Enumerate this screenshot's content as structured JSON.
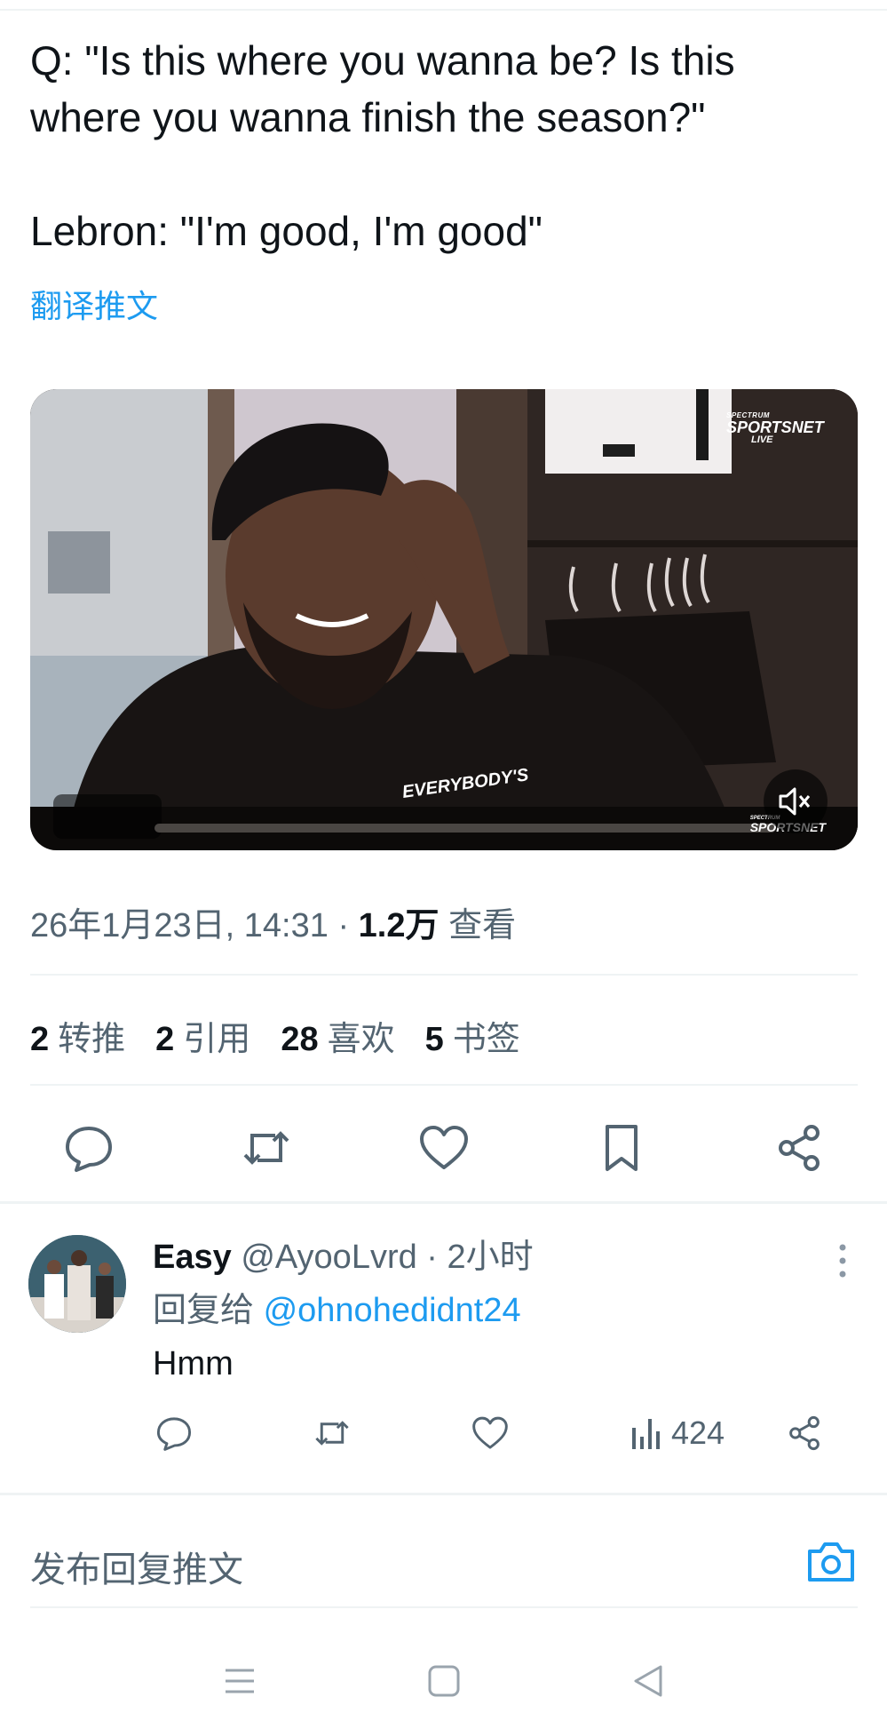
{
  "tweet": {
    "line1": "Q: \"Is this where you wanna be? Is this",
    "line2": "where you wanna finish the season?\"",
    "line3": "Lebron: \"I'm good, I'm good\"",
    "translate_label": "翻译推文"
  },
  "media": {
    "brand_small": "SPECTRUM",
    "brand_name": "SPORTSNET",
    "brand_live": "LIVE",
    "watermark_small": "SPECTRUM",
    "watermark_name": "SPORTSNET",
    "shirt_text": "EVERYBODY'S",
    "mute_icon": "volume-mute-icon",
    "progress": 0.02
  },
  "meta": {
    "timestamp": "26年1月23日, 14:31",
    "separator": "·",
    "views_count": "1.2万",
    "views_label": "查看"
  },
  "stats": [
    {
      "count": "2",
      "label": "转推"
    },
    {
      "count": "2",
      "label": "引用"
    },
    {
      "count": "28",
      "label": "喜欢"
    },
    {
      "count": "5",
      "label": "书签"
    }
  ],
  "actions": [
    "reply-icon",
    "retweet-icon",
    "like-icon",
    "bookmark-icon",
    "share-icon"
  ],
  "reply": {
    "name": "Easy",
    "handle": "@AyooLvrd · 2小时",
    "reply_to_label": "回复给",
    "reply_to_handle": "@ohnohedidnt24",
    "body": "Hmm",
    "views": "424"
  },
  "compose": {
    "placeholder": "发布回复推文",
    "camera_icon": "camera-icon"
  },
  "colors": {
    "accent": "#1d9bf0",
    "text_primary": "#0f1419",
    "text_secondary": "#536471",
    "divider": "#eff3f4"
  }
}
